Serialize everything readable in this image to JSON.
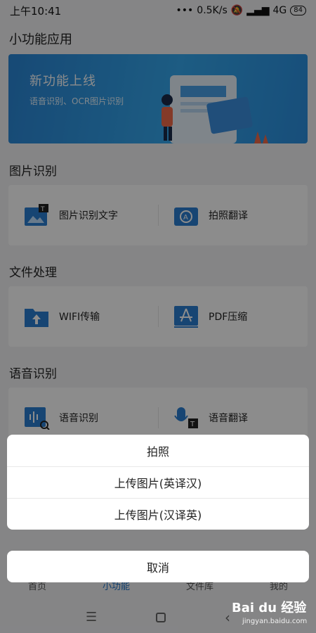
{
  "status": {
    "time": "上午10:41",
    "speed": "0.5K/s",
    "network": "4G",
    "battery": "84"
  },
  "page_title": "小功能应用",
  "banner": {
    "title": "新功能上线",
    "subtitle": "语音识别、OCR图片识别"
  },
  "sections": [
    {
      "title": "图片识别",
      "items": [
        {
          "label": "图片识别文字",
          "icon": "image-text-icon"
        },
        {
          "label": "拍照翻译",
          "icon": "camera-translate-icon"
        }
      ]
    },
    {
      "title": "文件处理",
      "items": [
        {
          "label": "WIFI传输",
          "icon": "folder-upload-icon"
        },
        {
          "label": "PDF压缩",
          "icon": "pdf-icon"
        }
      ]
    },
    {
      "title": "语音识别",
      "items": [
        {
          "label": "语音识别",
          "icon": "voice-search-icon"
        },
        {
          "label": "语音翻译",
          "icon": "mic-translate-icon"
        }
      ]
    }
  ],
  "tabs": [
    {
      "label": "首页"
    },
    {
      "label": "小功能"
    },
    {
      "label": "文件库"
    },
    {
      "label": "我的"
    }
  ],
  "action_sheet": {
    "options": [
      "拍照",
      "上传图片(英译汉)",
      "上传图片(汉译英)"
    ],
    "cancel": "取消"
  },
  "watermark": {
    "logo": "Bai du 经验",
    "url": "jingyan.baidu.com"
  },
  "colors": {
    "accent": "#1e73c8",
    "icon_blue": "#2a7fd1"
  }
}
